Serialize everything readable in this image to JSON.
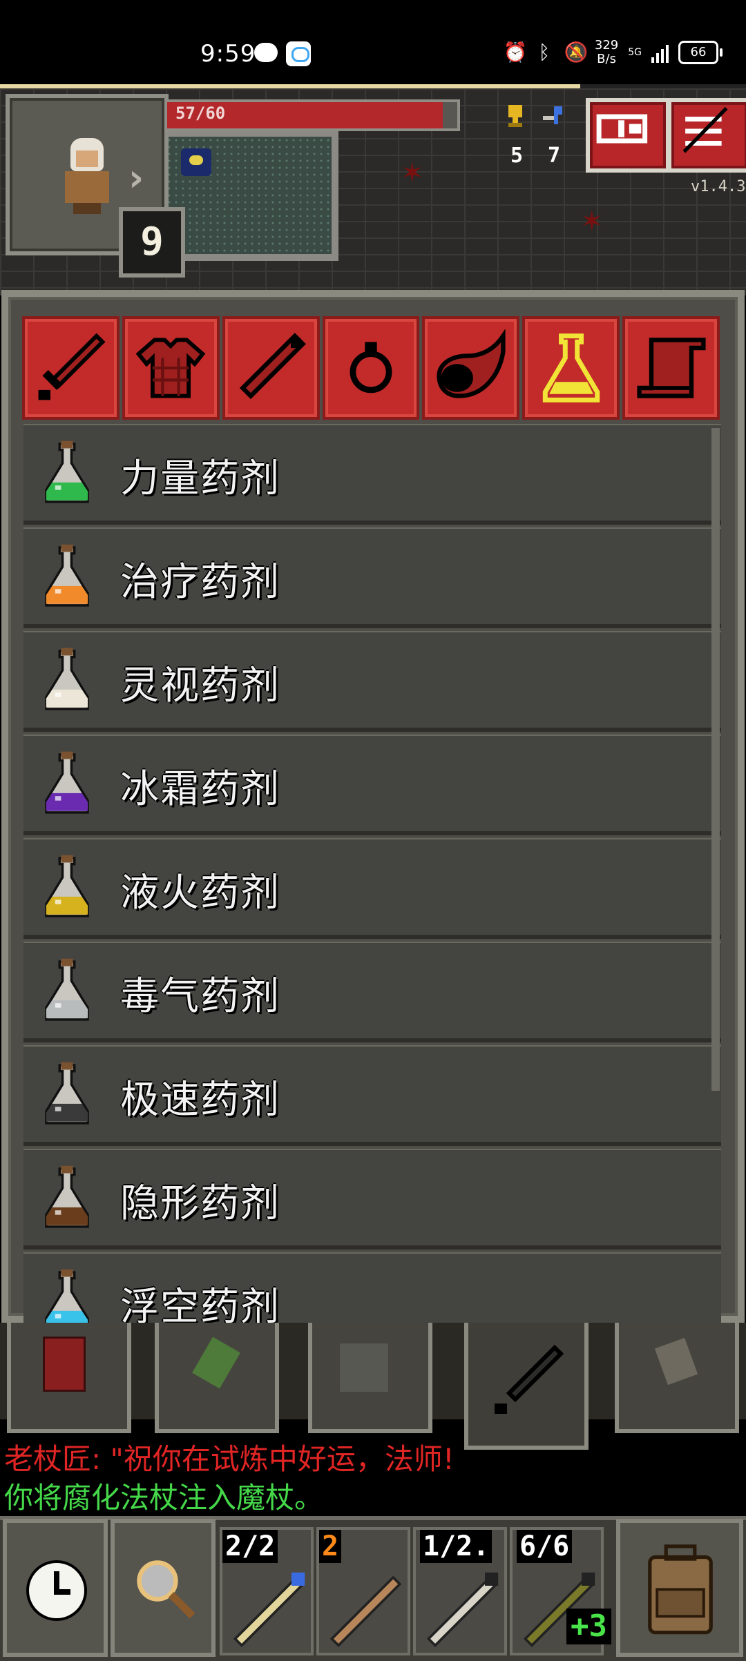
{
  "status_bar": {
    "time": "9:59",
    "net_speed_value": "329",
    "net_speed_unit": "B/s",
    "network": "5G",
    "battery": "66",
    "icons": [
      "wechat-icon",
      "chat-app-icon",
      "alarm-icon",
      "bluetooth-icon",
      "mute-bell-icon",
      "signal-icon",
      "battery-icon"
    ]
  },
  "hud": {
    "hp_text": "57/60",
    "hp_fraction": 0.95,
    "depth": "9",
    "challenges": "5",
    "keys": "7",
    "version": "v1.4.3",
    "buttons": [
      "journal-button",
      "menu-button"
    ]
  },
  "catalog": {
    "tabs": [
      {
        "name": "weapons",
        "icon": "sword-icon",
        "active": false
      },
      {
        "name": "armor",
        "icon": "armor-icon",
        "active": false
      },
      {
        "name": "wands",
        "icon": "wand-icon",
        "active": false
      },
      {
        "name": "rings",
        "icon": "ring-icon",
        "active": false
      },
      {
        "name": "artifacts",
        "icon": "horn-icon",
        "active": false
      },
      {
        "name": "potions",
        "icon": "potion-icon",
        "active": true
      },
      {
        "name": "scrolls",
        "icon": "scroll-icon",
        "active": false
      }
    ],
    "items": [
      {
        "label": "力量药剂",
        "color": "#2fb84c"
      },
      {
        "label": "治疗药剂",
        "color": "#f08a2a"
      },
      {
        "label": "灵视药剂",
        "color": "#ece6d8"
      },
      {
        "label": "冰霜药剂",
        "color": "#6a2bb0"
      },
      {
        "label": "液火药剂",
        "color": "#d6b21e"
      },
      {
        "label": "毒气药剂",
        "color": "#b8bcbc"
      },
      {
        "label": "极速药剂",
        "color": "#3a3a3a"
      },
      {
        "label": "隐形药剂",
        "color": "#6a3e1c"
      },
      {
        "label": "浮空药剂",
        "color": "#3ac3ea"
      }
    ]
  },
  "log": {
    "line1": "老杖匠: \"祝你在试炼中好运，法师!",
    "line2": "你将腐化法杖注入魔杖。",
    "line1_color": "#e02525",
    "line2_color": "#45d94a"
  },
  "toolbar": {
    "quickslots": [
      {
        "label": "2/2"
      },
      {
        "label": "2"
      },
      {
        "label": "1/2."
      },
      {
        "label": "6/6"
      }
    ],
    "upgrade": "+3"
  }
}
